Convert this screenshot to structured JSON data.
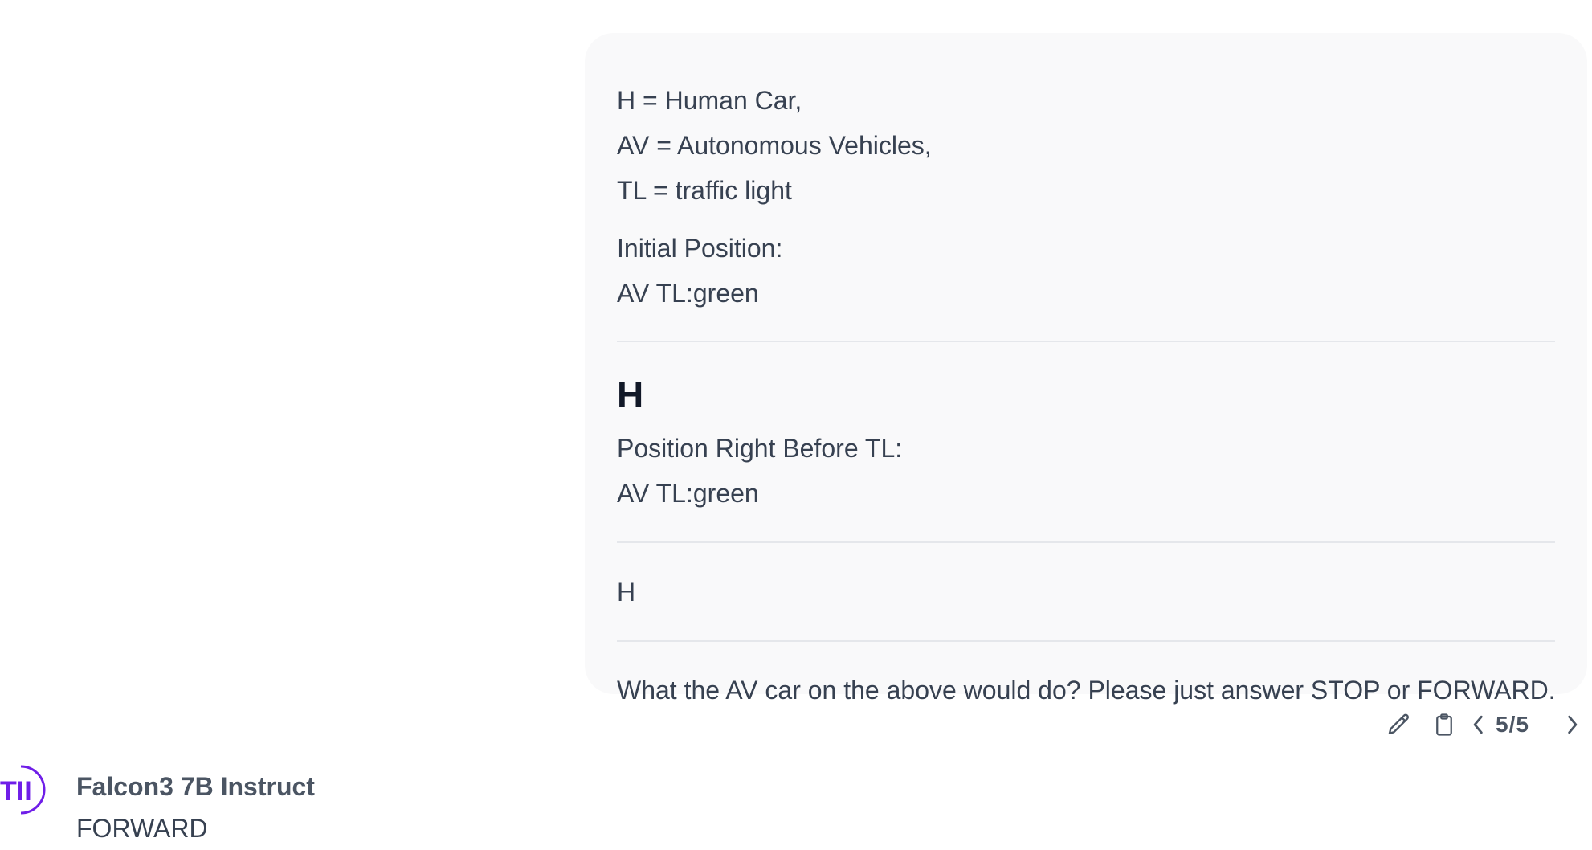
{
  "user_message": {
    "lines_top": [
      "H = Human Car,",
      "AV = Autonomous Vehicles,",
      "TL = traffic light"
    ],
    "initial_label": "Initial Position:",
    "initial_value": "AV TL:green",
    "heading": "H",
    "before_label": "Position Right Before TL:",
    "before_value": "AV TL:green",
    "plain_h": "H",
    "question": "What the AV car on the above would do? Please just answer STOP or FORWARD."
  },
  "actions": {
    "edit_icon": "pencil-icon",
    "copy_icon": "clipboard-icon",
    "prev_icon": "chevron-left-icon",
    "next_icon": "chevron-right-icon",
    "pager": "5/5"
  },
  "assistant": {
    "logo_icon": "tii-logo-icon",
    "model_name": "Falcon3 7B Instruct",
    "answer": "FORWARD"
  },
  "colors": {
    "bubble_bg": "#f9f9fa",
    "text": "#374151",
    "heading": "#111827",
    "divider": "#e5e7eb",
    "logo": "#6f1ee8"
  }
}
